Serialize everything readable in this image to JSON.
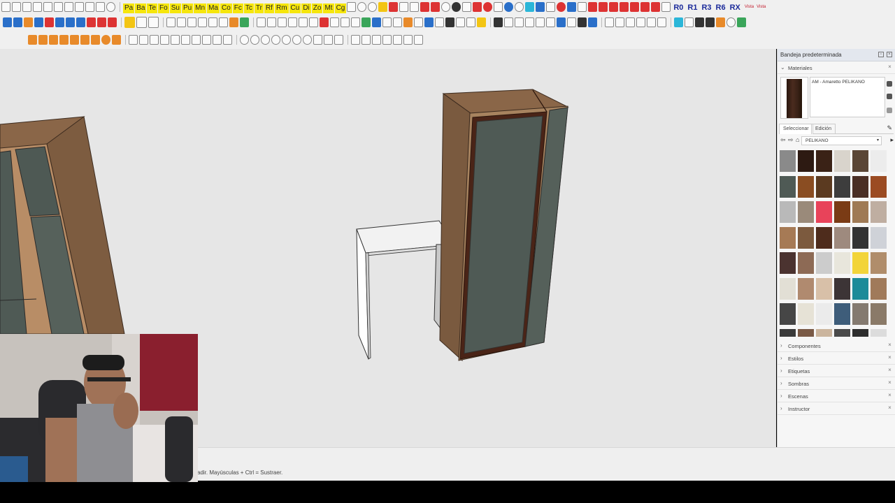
{
  "toolbar": {
    "row1_letter_buttons": [
      "Pa",
      "Ba",
      "Te",
      "Fo",
      "Su",
      "Pu",
      "Mn",
      "Ma",
      "Co",
      "Fc",
      "Tc",
      "Tr",
      "Rf",
      "Rm",
      "Cu",
      "Di",
      "Zo",
      "Mt",
      "Cg"
    ],
    "row1_right_labels": [
      "R0",
      "R1",
      "R3",
      "R6",
      "RX"
    ],
    "row1_tiny_labels": [
      "Vista",
      "Vista"
    ]
  },
  "colors": {
    "viewport_background": "#e6e6e6",
    "wood": "#8a6648",
    "door_panel": "#4f5a55",
    "door_frame": "#4a2417",
    "tray_header": "#e3e7ee"
  },
  "status": {
    "hint": "adir. Mayúsculas + Ctrl = Sustraer."
  },
  "tray": {
    "title": "Bandeja predeterminada",
    "materials": {
      "label": "Materiales",
      "current_name": "AM - Amaretto PELIKANO",
      "tabs": [
        "Seleccionar",
        "Edición"
      ],
      "library": "PELIKANO",
      "swatches": [
        "#8a8a8a",
        "#2d1a12",
        "#3a2216",
        "#d9d4cc",
        "#5a4636",
        "#ececec",
        "#4f5a55",
        "#8a4d22",
        "#5b3a20",
        "#3d3d3d",
        "#4a2e24",
        "#9b4b22",
        "#b9b9b9",
        "#9a8a7a",
        "#e8435a",
        "#7a3b15",
        "#9f7a55",
        "#bfaea1",
        "#a67a55",
        "#7c5a3e",
        "#4e2c1c",
        "#9e8a7e",
        "#333333",
        "#cfd2d8",
        "#4b3330",
        "#8d6a55",
        "#cccccc",
        "#e8e6dc",
        "#f2d43a",
        "#b08d6b",
        "#e2dfd5",
        "#b08a6f",
        "#d8c0a8",
        "#3c3436",
        "#1c8b99",
        "#a07a5a",
        "#464646",
        "#e6e2d6",
        "#ebebeb",
        "#3e5d7a",
        "#847a70",
        "#8a7a68",
        "#3a3a3a",
        "#7a5a46",
        "#cbb59e",
        "#4a4a4a",
        "#2e2e2e",
        "#dcdcdc"
      ]
    },
    "sections": [
      "Componentes",
      "Estilos",
      "Etiquetas",
      "Sombras",
      "Escenas",
      "Instructor"
    ]
  }
}
